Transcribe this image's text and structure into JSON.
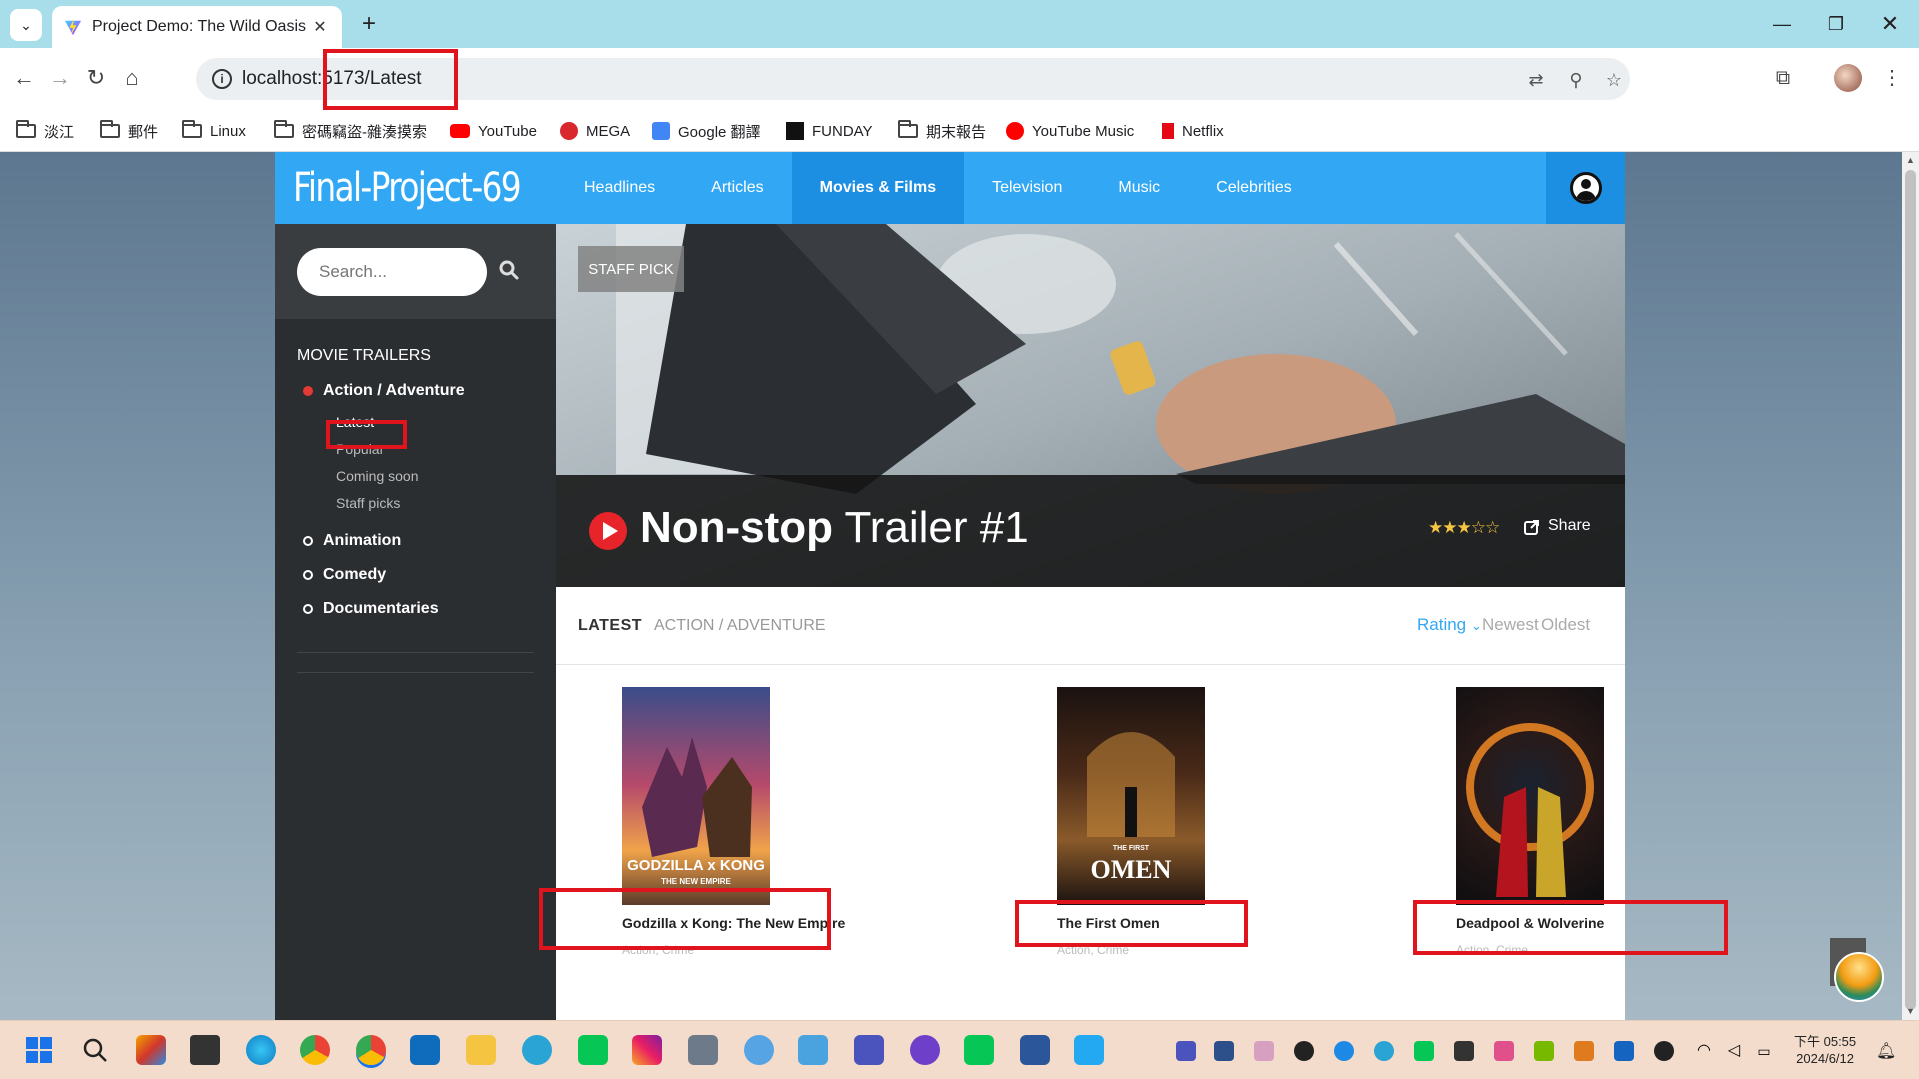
{
  "browser": {
    "tab_title": "Project Demo: The Wild Oasis",
    "tab_close": "✕",
    "new_tab": "+",
    "url": "localhost:5173/Latest",
    "window_controls": {
      "minimize": "—",
      "maximize": "❐",
      "close": "✕"
    },
    "nav": {
      "back": "←",
      "forward": "→",
      "reload": "↻",
      "home": "⌂"
    },
    "bookmarks": [
      {
        "label": "淡江",
        "icon": "folder-icon"
      },
      {
        "label": "郵件",
        "icon": "folder-icon"
      },
      {
        "label": "Linux",
        "icon": "folder-icon"
      },
      {
        "label": "密碼竊盜-雜湊摸索",
        "icon": "folder-icon"
      },
      {
        "label": "YouTube",
        "icon": "youtube-icon"
      },
      {
        "label": "MEGA",
        "icon": "mega-icon"
      },
      {
        "label": "Google 翻譯",
        "icon": "google-translate-icon"
      },
      {
        "label": "FUNDAY",
        "icon": "funday-icon"
      },
      {
        "label": "期末報告",
        "icon": "folder-icon"
      },
      {
        "label": "YouTube Music",
        "icon": "youtube-music-icon"
      },
      {
        "label": "Netflix",
        "icon": "netflix-icon"
      }
    ]
  },
  "site": {
    "logo": "Final-Project-69",
    "nav": [
      {
        "label": "Headlines",
        "active": false
      },
      {
        "label": "Articles",
        "active": false
      },
      {
        "label": "Movies & Films",
        "active": true
      },
      {
        "label": "Television",
        "active": false
      },
      {
        "label": "Music",
        "active": false
      },
      {
        "label": "Celebrities",
        "active": false
      }
    ],
    "search_placeholder": "Search...",
    "sidebar": {
      "title": "MOVIE TRAILERS",
      "categories": [
        {
          "label": "Action / Adventure",
          "selected": true,
          "subitems": [
            "Latest",
            "Popular",
            "Coming soon",
            "Staff picks"
          ],
          "current_subitem": "Latest"
        },
        {
          "label": "Animation",
          "selected": false
        },
        {
          "label": "Comedy",
          "selected": false
        },
        {
          "label": "Documentaries",
          "selected": false
        }
      ]
    },
    "hero": {
      "badge": "STAFF PICK",
      "title_bold": "Non-stop",
      "title_rest": " Trailer #1",
      "rating_stars": "★★★☆☆",
      "rating_value": 3.5,
      "share_label": "Share"
    },
    "list": {
      "heading": "LATEST",
      "category": "ACTION / ADVENTURE",
      "sort": [
        {
          "label": "Rating",
          "active": true,
          "caret": "⌄"
        },
        {
          "label": "Newest",
          "active": false
        },
        {
          "label": "Oldest",
          "active": false
        }
      ],
      "movies": [
        {
          "title": "Godzilla x Kong: The New Empire",
          "genre": "Action, Crime",
          "poster_text": "GODZILLA x KONG",
          "poster_sub": "THE NEW EMPIRE"
        },
        {
          "title": "The First Omen",
          "genre": "Action, Crime",
          "poster_text": "OMEN",
          "poster_sub": "THE FIRST"
        },
        {
          "title": "Deadpool & Wolverine",
          "genre": "Action, Crime",
          "poster_text": "",
          "poster_sub": ""
        }
      ]
    }
  },
  "taskbar": {
    "clock_time": "下午 05:55",
    "clock_date": "2024/6/12"
  },
  "colors": {
    "accent": "#32a8f5",
    "accent_dark": "#1d8fe3",
    "sidebar_bg": "#2b2e31",
    "highlight_box": "#e0141d"
  }
}
